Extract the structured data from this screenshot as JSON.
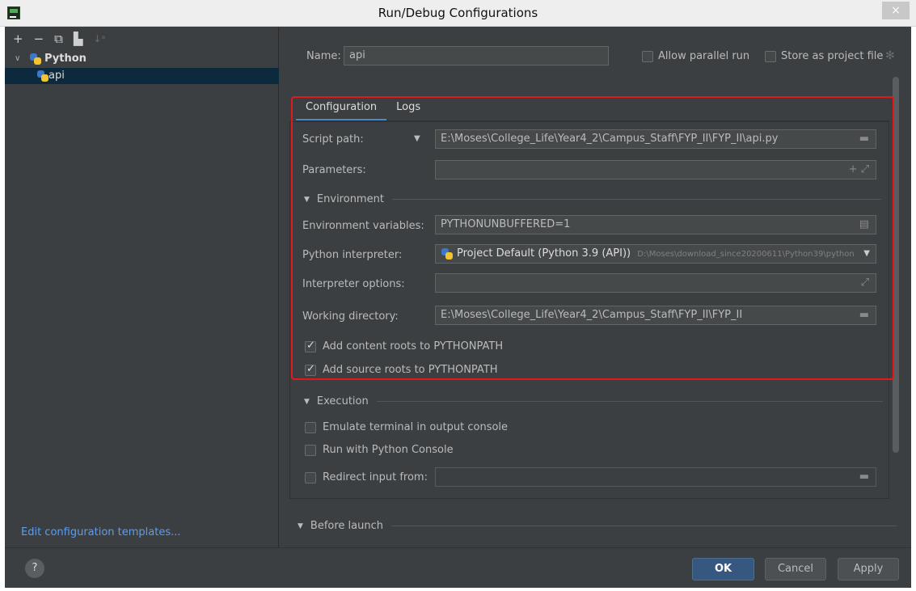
{
  "window": {
    "title": "Run/Debug Configurations",
    "close_glyph": "×"
  },
  "left": {
    "toolbar": [
      "+",
      "−",
      "⧉",
      "▙",
      "↓ᵃ"
    ],
    "tree": {
      "group_label": "Python",
      "item_label": "api"
    },
    "edit_templates": "Edit configuration templates..."
  },
  "header": {
    "name_label": "Name:",
    "name_value": "api",
    "allow_parallel": "Allow parallel run",
    "store_project": "Store as project file"
  },
  "tabs": [
    "Configuration",
    "Logs"
  ],
  "config": {
    "script_label": "Script path:",
    "script_value": "E:\\Moses\\College_Life\\Year4_2\\Campus_Staff\\FYP_II\\FYP_II\\api.py",
    "params_label": "Parameters:",
    "params_value": "",
    "env_section": "Environment",
    "env_vars_label": "Environment variables:",
    "env_vars_value": "PYTHONUNBUFFERED=1",
    "interp_label": "Python interpreter:",
    "interp_value": "Project Default (Python 3.9 (API))",
    "interp_path": "D:\\Moses\\download_since20200611\\Python39\\python",
    "interp_opts_label": "Interpreter options:",
    "interp_opts_value": "",
    "workdir_label": "Working directory:",
    "workdir_value": "E:\\Moses\\College_Life\\Year4_2\\Campus_Staff\\FYP_II\\FYP_II",
    "content_roots": "Add content roots to PYTHONPATH",
    "source_roots": "Add source roots to PYTHONPATH"
  },
  "execution": {
    "section": "Execution",
    "emulate_terminal": "Emulate terminal in output console",
    "python_console": "Run with Python Console",
    "redirect_input": "Redirect input from:"
  },
  "before_launch": {
    "section": "Before launch"
  },
  "buttons": {
    "help": "?",
    "ok": "OK",
    "cancel": "Cancel",
    "apply": "Apply"
  },
  "colors": {
    "accent": "#4a88c7",
    "highlight_box": "#e4171a",
    "link": "#589df6",
    "ok_button": "#365880"
  }
}
